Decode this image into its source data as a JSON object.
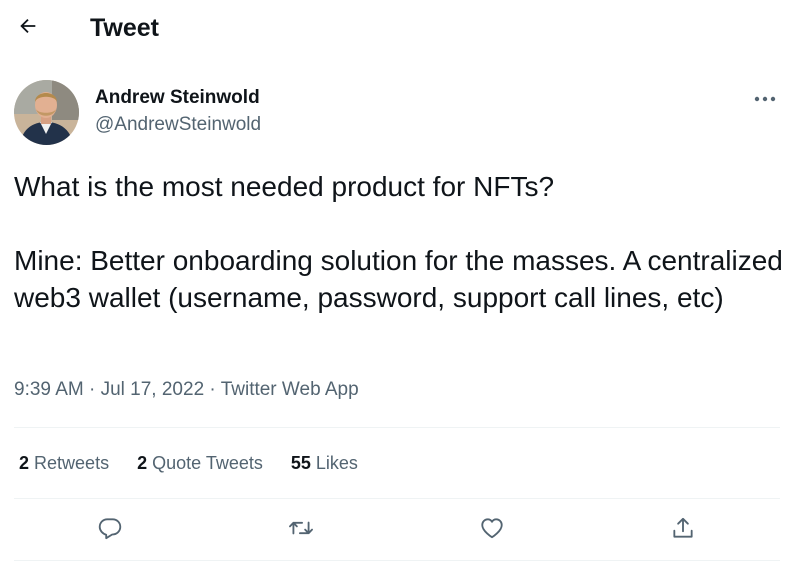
{
  "header": {
    "title": "Tweet",
    "back_icon": "arrow-left-icon"
  },
  "author": {
    "name": "Andrew Steinwold",
    "handle": "@AndrewSteinwold"
  },
  "tweet": {
    "text": "What is the most needed product for NFTs?\n\nMine: Better onboarding solution for the masses. A centralized web3 wallet (username, password, support call lines, etc)",
    "time": "9:39 AM",
    "separator": "·",
    "date": "Jul 17, 2022",
    "source": "Twitter Web App"
  },
  "stats": {
    "retweets_count": "2",
    "retweets_label": "Retweets",
    "quotes_count": "2",
    "quotes_label": "Quote Tweets",
    "likes_count": "55",
    "likes_label": "Likes"
  },
  "actions": [
    "reply-icon",
    "retweet-icon",
    "like-icon",
    "share-icon"
  ],
  "colors": {
    "text_primary": "#0f1419",
    "text_secondary": "#536471",
    "divider": "#eff3f4"
  }
}
